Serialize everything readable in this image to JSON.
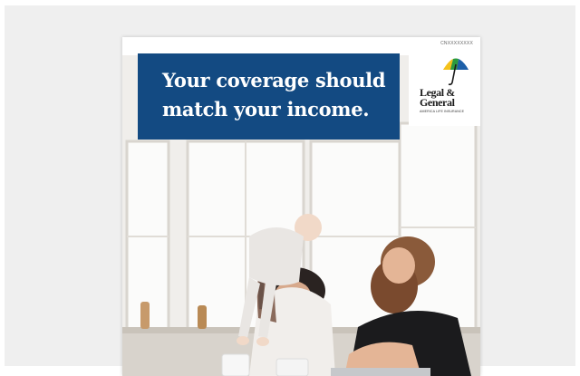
{
  "ad": {
    "code": "CNXXXXXXXX",
    "headline_line1": "Your coverage should",
    "headline_line2": "match your income.",
    "brand": {
      "line1": "Legal &",
      "line2": "General",
      "tagline": "AMERICA LIFE INSURANCE"
    },
    "colors": {
      "headline_bg": "#134a82",
      "page_bg": "#efefef"
    }
  }
}
